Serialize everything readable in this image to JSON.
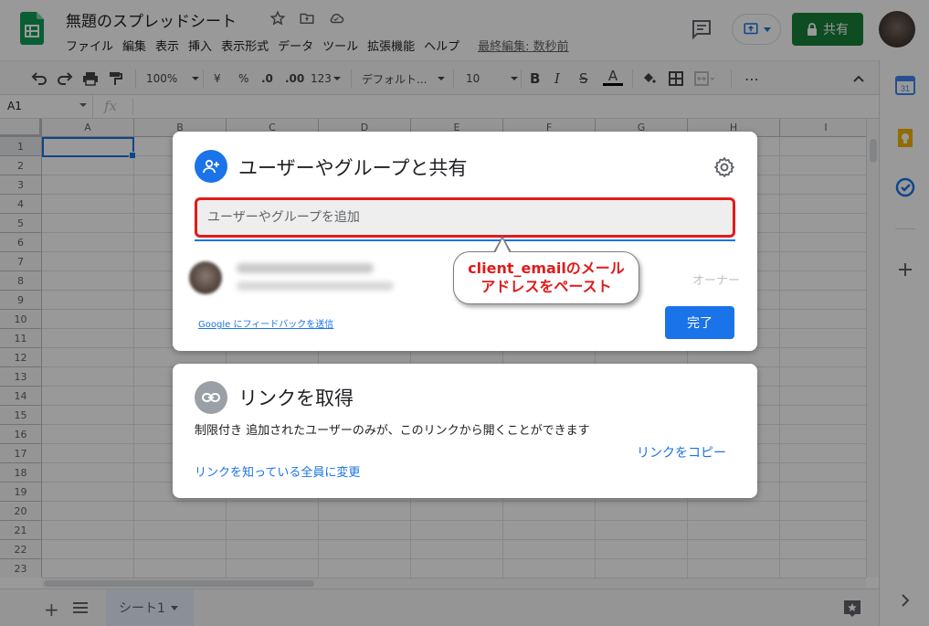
{
  "header": {
    "doc_title": "無題のスプレッドシート",
    "menu": [
      "ファイル",
      "編集",
      "表示",
      "挿入",
      "表示形式",
      "データ",
      "ツール",
      "拡張機能",
      "ヘルプ"
    ],
    "last_edit": "最終編集: 数秒前",
    "share_label": "共有"
  },
  "toolbar": {
    "zoom": "100%",
    "currency": "¥",
    "percent": "%",
    "dec_decrease": ".0",
    "dec_increase": ".00",
    "format_more": "123",
    "font": "デフォルト...",
    "font_size": "10",
    "bold": "B",
    "italic": "I",
    "strike": "S",
    "text_color": "A",
    "more": "⋯"
  },
  "formula_bar": {
    "name_box": "A1",
    "fx": "fx"
  },
  "grid": {
    "columns": [
      "A",
      "B",
      "C",
      "D",
      "E",
      "F",
      "G",
      "H",
      "I"
    ],
    "rows": [
      "1",
      "2",
      "3",
      "4",
      "5",
      "6",
      "7",
      "8",
      "9",
      "10",
      "11",
      "12",
      "13",
      "14",
      "15",
      "16",
      "17",
      "18",
      "19",
      "20",
      "21",
      "22",
      "23"
    ]
  },
  "sheetbar": {
    "add": "+",
    "sheet_name": "シート1"
  },
  "share_dialog": {
    "title": "ユーザーやグループと共有",
    "input_placeholder": "ユーザーやグループを追加",
    "owner_role": "オーナー",
    "feedback": "Google にフィードバックを送信",
    "done": "完了"
  },
  "callout": {
    "line1": "client_emailのメール",
    "line2": "アドレスをペースト"
  },
  "link_dialog": {
    "title": "リンクを取得",
    "description": "制限付き 追加されたユーザーのみが、このリンクから開くことができます",
    "change": "リンクを知っている全員に変更",
    "copy": "リンクをコピー"
  },
  "colors": {
    "accent": "#1a73e8",
    "share_green": "#188038",
    "highlight_red": "#e11b1b"
  }
}
